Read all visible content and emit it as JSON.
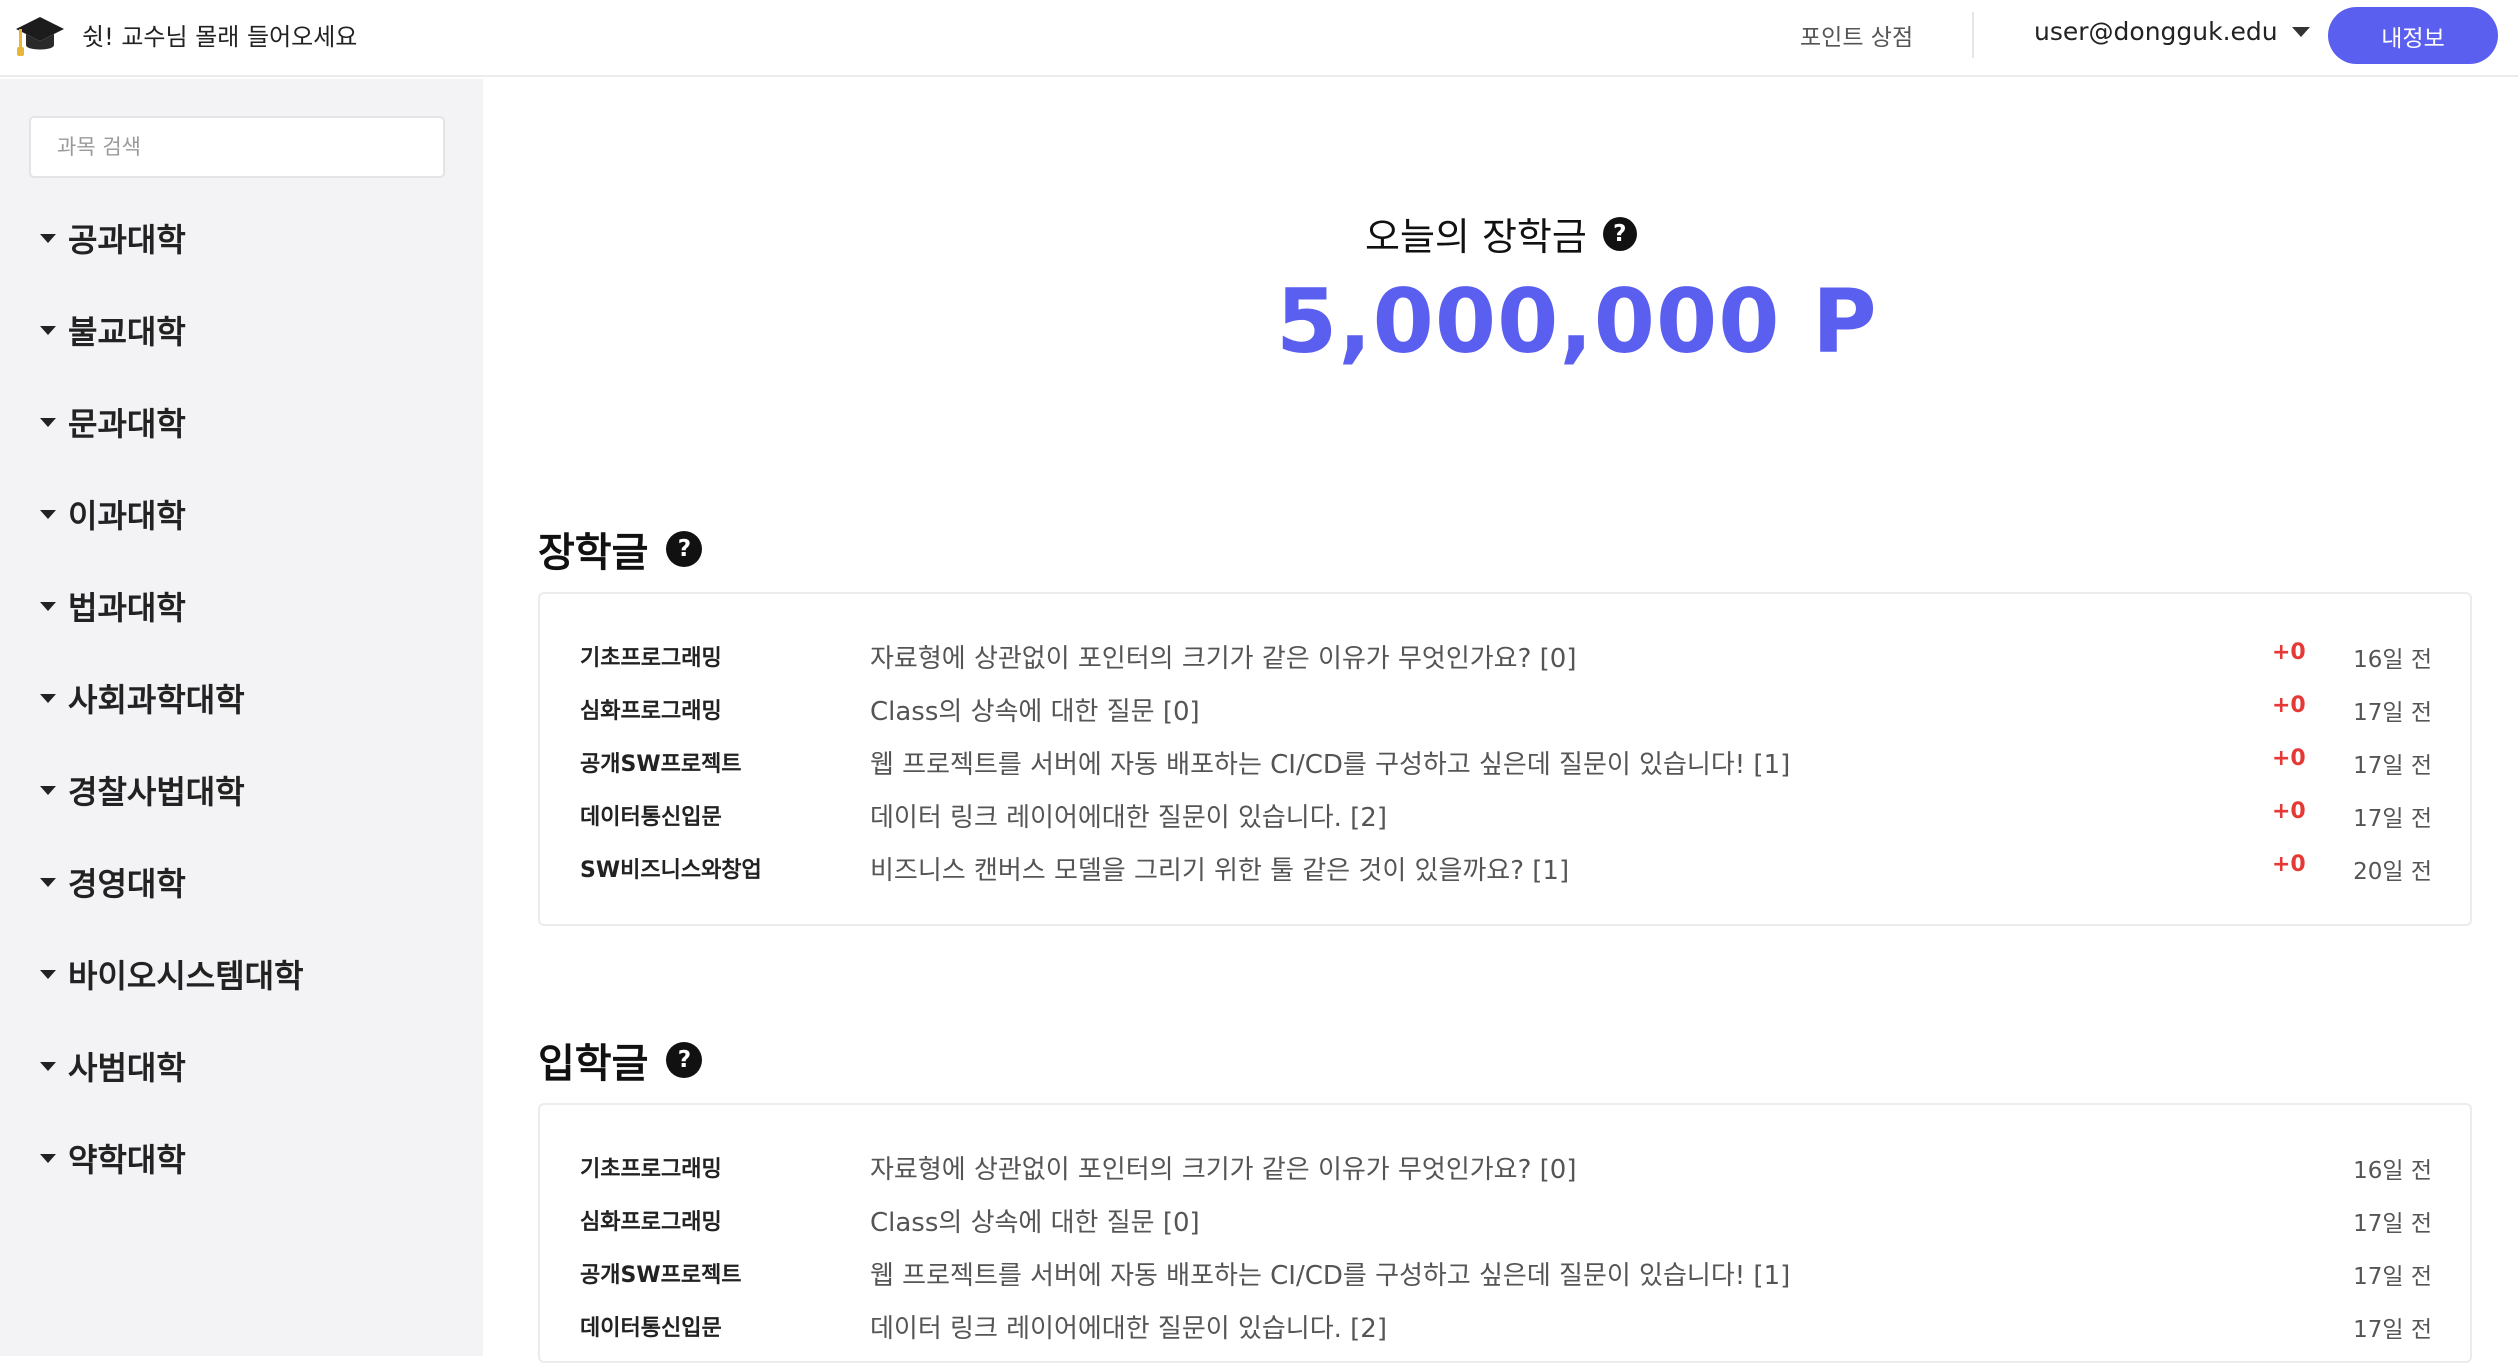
{
  "header": {
    "logo_icon": "graduation-cap-icon",
    "brand": "쉿! 교수님 몰래 들어오세요",
    "shop_link": "포인트 상점",
    "user_email": "user@dongguk.edu",
    "mypage_button": "내정보"
  },
  "sidebar": {
    "search_placeholder": "과목 검색",
    "colleges": [
      {
        "label": "공과대학"
      },
      {
        "label": "불교대학"
      },
      {
        "label": "문과대학"
      },
      {
        "label": "이과대학"
      },
      {
        "label": "법과대학"
      },
      {
        "label": "사회과학대학"
      },
      {
        "label": "경찰사법대학"
      },
      {
        "label": "경영대학"
      },
      {
        "label": "바이오시스템대학"
      },
      {
        "label": "사범대학"
      },
      {
        "label": "약학대학"
      }
    ]
  },
  "hero": {
    "title": "오늘의 장학금",
    "amount": "5,000,000 P"
  },
  "scholarship": {
    "title": "장학글",
    "posts": [
      {
        "course": "기초프로그래밍",
        "title": "자료형에 상관없이 포인터의 크기가 같은 이유가 무엇인가요? [0]",
        "points": "+0",
        "time": "16일 전"
      },
      {
        "course": "심화프로그래밍",
        "title": "Class의 상속에 대한 질문 [0]",
        "points": "+0",
        "time": "17일 전"
      },
      {
        "course": "공개SW프로젝트",
        "title": "웹 프로젝트를 서버에 자동 배포하는 CI/CD를 구성하고 싶은데 질문이 있습니다! [1]",
        "points": "+0",
        "time": "17일 전"
      },
      {
        "course": "데이터통신입문",
        "title": "데이터 링크 레이어에대한 질문이 있습니다. [2]",
        "points": "+0",
        "time": "17일 전"
      },
      {
        "course": "SW비즈니스와창업",
        "title": "비즈니스 캔버스 모델을 그리기 위한 툴 같은 것이 있을까요? [1]",
        "points": "+0",
        "time": "20일 전"
      }
    ]
  },
  "admission": {
    "title": "입학글",
    "posts": [
      {
        "course": "기초프로그래밍",
        "title": "자료형에 상관없이 포인터의 크기가 같은 이유가 무엇인가요? [0]",
        "time": "16일 전"
      },
      {
        "course": "심화프로그래밍",
        "title": "Class의 상속에 대한 질문 [0]",
        "time": "17일 전"
      },
      {
        "course": "공개SW프로젝트",
        "title": "웹 프로젝트를 서버에 자동 배포하는 CI/CD를 구성하고 싶은데 질문이 있습니다! [1]",
        "time": "17일 전"
      },
      {
        "course": "데이터통신입문",
        "title": "데이터 링크 레이어에대한 질문이 있습니다. [2]",
        "time": "17일 전"
      }
    ]
  },
  "colors": {
    "accent": "#5b5ff0",
    "points": "#e53935",
    "sidebar_bg": "#f3f3f5"
  }
}
